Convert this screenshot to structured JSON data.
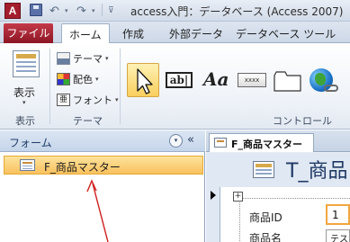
{
  "window": {
    "app_icon_letter": "A",
    "title": "access入門：データベース (Access 2007)"
  },
  "quick_access": {
    "undo_icon": "undo-icon",
    "redo_icon": "redo-icon",
    "dropdown_glyph": "▾",
    "customize_glyph": "⊽"
  },
  "ribbon_tabs": {
    "file": "ファイル",
    "items": [
      "ホーム",
      "作成",
      "外部データ",
      "データベース ツール"
    ],
    "active": "ホーム"
  },
  "ribbon": {
    "views_group": {
      "button": "表示",
      "dropdown": "▾",
      "label": "表示"
    },
    "themes_group": {
      "items": [
        {
          "label": "テーマ",
          "icon": "theme-icon"
        },
        {
          "label": "配色",
          "icon": "color-icon"
        },
        {
          "label": "フォント",
          "icon": "font-icon"
        }
      ],
      "font_icon_glyph": "亜",
      "dropdown": "▾",
      "label": "テーマ"
    },
    "controls_group": {
      "label": "コントロール",
      "textbox_glyph": "ab|",
      "label_glyph": "Aa",
      "button_glyph": "xxxx",
      "tools": [
        "select-tool",
        "textbox-tool",
        "label-tool",
        "button-tool",
        "tab-control-tool",
        "hyperlink-tool"
      ]
    }
  },
  "nav_pane": {
    "title": "フォーム",
    "menu_glyph": "▾",
    "shutter_glyph": "«",
    "items": [
      {
        "label": "F_商品マスター",
        "selected": true
      }
    ]
  },
  "document": {
    "tab_label": "F_商品マスター",
    "form_title": "T_商品",
    "layout_handle_glyph": "+",
    "fields": [
      {
        "label": "商品ID",
        "value": "1"
      },
      {
        "label": "商品名",
        "value": "テスト"
      }
    ]
  },
  "colors": {
    "file_tab": "#a91e2f",
    "selected_item": "#f9c15f",
    "accent_annotation": "#d11e1e",
    "form_title": "#1f3864"
  }
}
